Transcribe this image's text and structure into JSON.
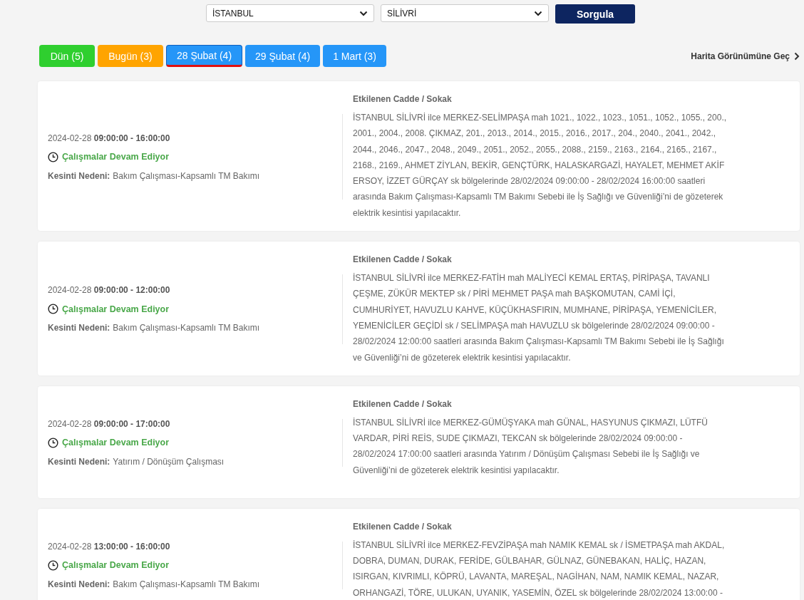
{
  "filters": {
    "province": "İSTANBUL",
    "district": "SİLİVRİ",
    "submit": "Sorgula"
  },
  "tabs": [
    {
      "label": "Dün (5)",
      "kind": "past",
      "selected": false
    },
    {
      "label": "Bugün (3)",
      "kind": "today",
      "selected": false
    },
    {
      "label": "28 Şubat (4)",
      "kind": "future",
      "selected": true
    },
    {
      "label": "29 Şubat (4)",
      "kind": "future",
      "selected": false
    },
    {
      "label": "1 Mart (3)",
      "kind": "future",
      "selected": false
    }
  ],
  "map_link": "Harita Görünümüne Geç",
  "outages": [
    {
      "date": "2024-02-28",
      "time": "09:00:00 - 16:00:00",
      "status": "Çalışmalar Devam Ediyor",
      "reason_label": "Kesinti Nedeni:",
      "reason": "Bakım Çalışması-Kapsamlı TM Bakımı",
      "streets_title": "Etkilenen Cadde / Sokak",
      "streets": "İSTANBUL SİLİVRİ ilce MERKEZ-SELİMPAŞA mah 1021., 1022., 1023., 1051., 1052., 1055., 200., 2001., 2004., 2008. ÇIKMAZ, 201., 2013., 2014., 2015., 2016., 2017., 204., 2040., 2041., 2042., 2044., 2046., 2047., 2048., 2049., 2051., 2052., 2055., 2088., 2159., 2163., 2164., 2165., 2167., 2168., 2169., AHMET ZİYLAN, BEKİR, GENÇTÜRK, HALASKARGAZİ, HAYALET, MEHMET AKİF ERSOY, İZZET GÜRÇAY sk bölgelerinde 28/02/2024 09:00:00 - 28/02/2024 16:00:00 saatleri arasında Bakım Çalışması-Kapsamlı TM Bakımı Sebebi ile İş Sağlığı ve Güvenliği’ni de gözeterek elektrik kesintisi yapılacaktır."
    },
    {
      "date": "2024-02-28",
      "time": "09:00:00 - 12:00:00",
      "status": "Çalışmalar Devam Ediyor",
      "reason_label": "Kesinti Nedeni:",
      "reason": "Bakım Çalışması-Kapsamlı TM Bakımı",
      "streets_title": "Etkilenen Cadde / Sokak",
      "streets": "İSTANBUL SİLİVRİ ilce MERKEZ-FATİH mah MALİYECİ KEMAL ERTAŞ, PİRİPAŞA, TAVANLI ÇEŞME, ZÜKÜR MEKTEP sk / PİRİ MEHMET PAŞA mah BAŞKOMUTAN, CAMİ İÇİ, CUMHURİYET, HAVUZLU KAHVE, KÜÇÜKHASFIRIN, MUMHANE, PİRİPAŞA, YEMENİCİLER, YEMENİCİLER GEÇİDİ sk / SELİMPAŞA mah HAVUZLU sk bölgelerinde 28/02/2024 09:00:00 - 28/02/2024 12:00:00 saatleri arasında Bakım Çalışması-Kapsamlı TM Bakımı Sebebi ile İş Sağlığı ve Güvenliği’ni de gözeterek elektrik kesintisi yapılacaktır."
    },
    {
      "date": "2024-02-28",
      "time": "09:00:00 - 17:00:00",
      "status": "Çalışmalar Devam Ediyor",
      "reason_label": "Kesinti Nedeni:",
      "reason": "Yatırım / Dönüşüm Çalışması",
      "streets_title": "Etkilenen Cadde / Sokak",
      "streets": "İSTANBUL SİLİVRİ ilce MERKEZ-GÜMÜŞYAKA mah GÜNAL, HASYUNUS ÇIKMAZI, LÜTFÜ VARDAR, PİRİ REİS, SUDE ÇIKMAZI, TEKCAN sk bölgelerinde 28/02/2024 09:00:00 - 28/02/2024 17:00:00 saatleri arasında Yatırım / Dönüşüm Çalışması Sebebi ile İş Sağlığı ve Güvenliği’ni de gözeterek elektrik kesintisi yapılacaktır."
    },
    {
      "date": "2024-02-28",
      "time": "13:00:00 - 16:00:00",
      "status": "Çalışmalar Devam Ediyor",
      "reason_label": "Kesinti Nedeni:",
      "reason": "Bakım Çalışması-Kapsamlı TM Bakımı",
      "streets_title": "Etkilenen Cadde / Sokak",
      "streets": "İSTANBUL SİLİVRİ ilce MERKEZ-FEVZİPAŞA mah NAMIK KEMAL sk / İSMETPAŞA mah AKDAL, DOBRA, DUMAN, DURAK, FERİDE, GÜLBAHAR, GÜLNAZ, GÜNEBAKAN, HALİÇ, HAZAN, ISIRGAN, KIVRIMLI, KÖPRÜ, LAVANTA, MAREŞAL, NAGİHAN, NAM, NAMIK KEMAL, NAZAR, ORHANGAZİ, TÖRE, ULUKAN, UYANIK, YASEMİN, ÖZEL sk bölgelerinde 28/02/2024 13:00:00 -"
    }
  ]
}
